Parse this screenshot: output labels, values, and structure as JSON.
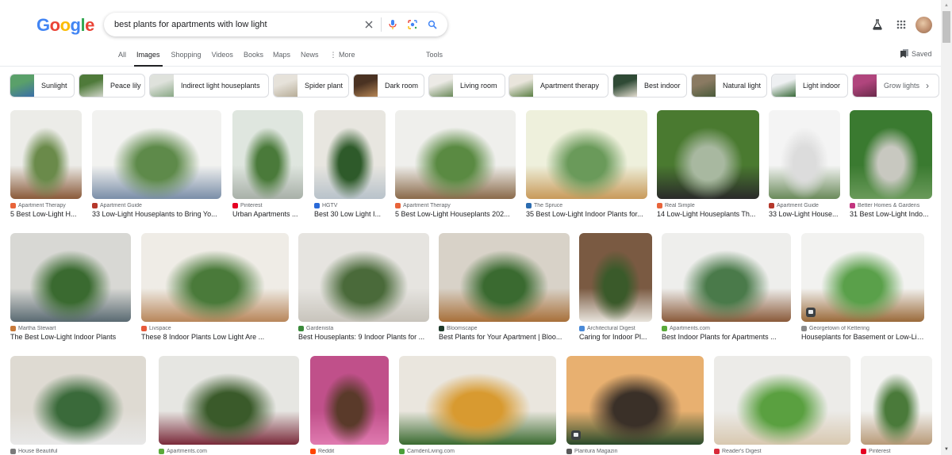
{
  "header": {
    "logo": [
      "G",
      "o",
      "o",
      "g",
      "l",
      "e"
    ],
    "search": {
      "query": "best plants for apartments with low light",
      "clear_icon": "close-icon",
      "voice_icon": "microphone-icon",
      "lens_icon": "lens-icon",
      "search_icon": "search-icon"
    },
    "labs_icon": "flask-icon",
    "apps_icon": "apps-grid-icon",
    "avatar": "account-avatar"
  },
  "tabs": [
    {
      "label": "All",
      "active": false
    },
    {
      "label": "Images",
      "active": true
    },
    {
      "label": "Shopping",
      "active": false
    },
    {
      "label": "Videos",
      "active": false
    },
    {
      "label": "Books",
      "active": false
    },
    {
      "label": "Maps",
      "active": false
    },
    {
      "label": "News",
      "active": false
    },
    {
      "label": "⋮ More",
      "active": false
    }
  ],
  "tools_label": "Tools",
  "saved_label": "Saved",
  "chips": [
    {
      "label": "Sunlight",
      "colors": [
        "#5aa06a",
        "#3a6ea8"
      ]
    },
    {
      "label": "Peace lily",
      "colors": [
        "#4f7a3a",
        "#cfd4c8"
      ]
    },
    {
      "label": "Indirect light houseplants",
      "colors": [
        "#dfe2dc",
        "#8aa886"
      ]
    },
    {
      "label": "Spider plant",
      "colors": [
        "#e6e2da",
        "#b7ad98"
      ]
    },
    {
      "label": "Dark room",
      "colors": [
        "#4a3222",
        "#b58555"
      ]
    },
    {
      "label": "Living room",
      "colors": [
        "#eceae6",
        "#6b8a5a"
      ]
    },
    {
      "label": "Apartment therapy",
      "colors": [
        "#e9e5dc",
        "#5b7f44"
      ]
    },
    {
      "label": "Best indoor",
      "colors": [
        "#2f4a35",
        "#e2dccf"
      ]
    },
    {
      "label": "Natural light",
      "colors": [
        "#8a7a62",
        "#4a5a3a"
      ]
    },
    {
      "label": "Light indoor",
      "colors": [
        "#eef0f2",
        "#3a6a3a"
      ]
    },
    {
      "label": "Grow lights",
      "colors": [
        "#b0457d",
        "#6a2a4a"
      ]
    }
  ],
  "results": [
    {
      "source": "Apartment Therapy",
      "title": "5 Best Low-Light H...",
      "favicon": "#e8643a",
      "colors": [
        "#ecece8",
        "#6a8a4a",
        "#8a5a3a"
      ]
    },
    {
      "source": "Apartment Guide",
      "title": "33 Low-Light Houseplants to Bring Yo...",
      "favicon": "#b5382b",
      "colors": [
        "#f2f2f0",
        "#5e8a4a",
        "#7a8ea8"
      ]
    },
    {
      "source": "Pinterest",
      "title": "Urban Apartments ...",
      "favicon": "#e60023",
      "colors": [
        "#dfe6df",
        "#4a7a3a",
        "#a8b0a8"
      ]
    },
    {
      "source": "HGTV",
      "title": "Best 30 Low Light I...",
      "favicon": "#2a6ad8",
      "colors": [
        "#e8e6e0",
        "#2e5a2a",
        "#b8c2ca"
      ]
    },
    {
      "source": "Apartment Therapy",
      "title": "5 Best Low-Light Houseplants 202...",
      "favicon": "#e8643a",
      "colors": [
        "#efefec",
        "#5a8a42",
        "#8a6a4a"
      ]
    },
    {
      "source": "The Spruce",
      "title": "35 Best Low-Light Indoor Plants for...",
      "favicon": "#2b6cb0",
      "colors": [
        "#eef0dc",
        "#6a9a5a",
        "#c89a5a"
      ]
    },
    {
      "source": "Real Simple",
      "title": "14 Low-Light Houseplants Th...",
      "favicon": "#e8643a",
      "colors": [
        "#4a7a30",
        "#a8b8a0",
        "#2a2a2a"
      ]
    },
    {
      "source": "Apartment Guide",
      "title": "33 Low-Light House...",
      "favicon": "#b5382b",
      "colors": [
        "#f4f4f4",
        "#dcdcdc",
        "#6a8a5a"
      ]
    },
    {
      "source": "Better Homes & Gardens",
      "title": "31 Best Low-Light Indo...",
      "favicon": "#c2357e",
      "colors": [
        "#3a7a30",
        "#c8c8c0",
        "#6a9a5a"
      ]
    },
    {
      "source": "Martha Stewart",
      "title": "The Best Low-Light Indoor Plants",
      "favicon": "#c87a3a",
      "colors": [
        "#d8d8d4",
        "#3a6a30",
        "#5a6a72"
      ]
    },
    {
      "source": "Livspace",
      "title": "These 8 Indoor Plants Low Light Are ...",
      "favicon": "#e85a3a",
      "colors": [
        "#efece6",
        "#4a7a3a",
        "#b8865a"
      ]
    },
    {
      "source": "Gardenista",
      "title": "Best Houseplants: 9 Indoor Plants for ...",
      "favicon": "#3a8a3a",
      "colors": [
        "#e6e4e0",
        "#4a6a3a",
        "#c8c4bc"
      ]
    },
    {
      "source": "Bloomscape",
      "title": "Best Plants for Your Apartment | Bloo...",
      "favicon": "#1e3a2a",
      "colors": [
        "#d8d2c8",
        "#3a6a30",
        "#a8703a"
      ]
    },
    {
      "source": "Architectural Digest",
      "title": "Caring for Indoor Pl...",
      "favicon": "#4a8ad8",
      "colors": [
        "#7a5a42",
        "#3a5a2a",
        "#e8e4dc"
      ]
    },
    {
      "source": "Apartments.com",
      "title": "Best Indoor Plants for Apartments ...",
      "favicon": "#5aaa3a",
      "colors": [
        "#eeeeec",
        "#4a7a4a",
        "#8a5a3a"
      ]
    },
    {
      "source": "Georgetown of Kettering",
      "title": "Houseplants for Basement or Low-Lig...",
      "favicon": "#8a8a8a",
      "colors": [
        "#f2f2f0",
        "#5aa04a",
        "#9a6a3a"
      ]
    },
    {
      "source": "House Beautiful",
      "title": "",
      "favicon": "#7a7a7a",
      "colors": [
        "#dedad2",
        "#3a6a3a",
        "#e8e8e8"
      ]
    },
    {
      "source": "Apartments.com",
      "title": "",
      "favicon": "#5aaa3a",
      "colors": [
        "#e6e6e2",
        "#3a5a2a",
        "#7a2a3a"
      ]
    },
    {
      "source": "Reddit",
      "title": "",
      "favicon": "#ff4500",
      "colors": [
        "#c0508a",
        "#5a3a2a",
        "#e07ab0"
      ]
    },
    {
      "source": "CamdenLiving.com",
      "title": "",
      "favicon": "#4aa03a",
      "colors": [
        "#eae6de",
        "#d89a30",
        "#3a6a30"
      ]
    },
    {
      "source": "Plantura Magazin",
      "title": "",
      "favicon": "#5a5a5a",
      "colors": [
        "#e8b070",
        "#3a3028",
        "#2a4a2a"
      ]
    },
    {
      "source": "Reader's Digest",
      "title": "",
      "favicon": "#d82a3a",
      "colors": [
        "#ecebe8",
        "#5aa040",
        "#d8c8b0"
      ]
    },
    {
      "source": "Pinterest",
      "title": "",
      "favicon": "#e60023",
      "colors": [
        "#f2f2f0",
        "#4a7a3a",
        "#b89a78"
      ]
    }
  ]
}
